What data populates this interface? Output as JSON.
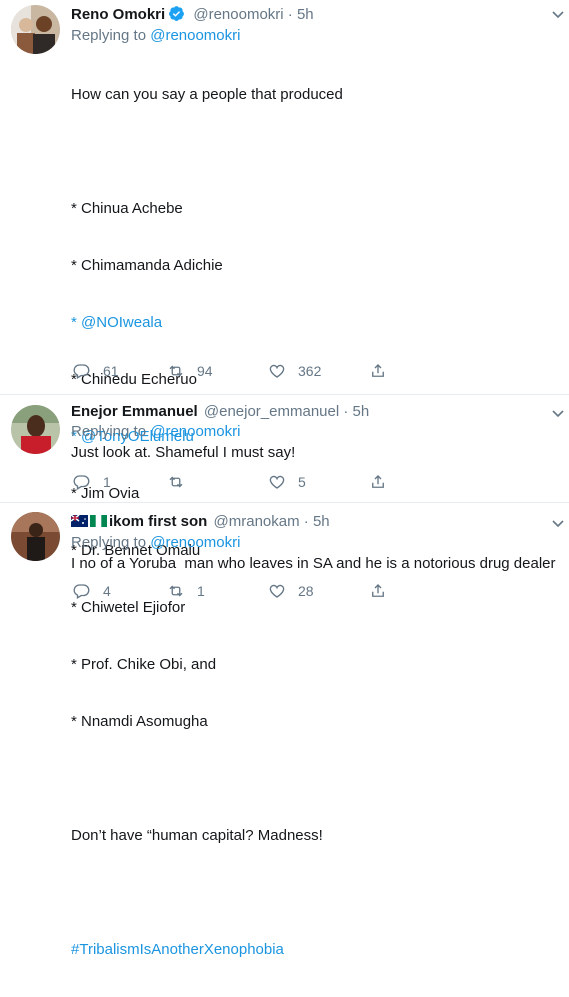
{
  "tweets": [
    {
      "name": "Reno Omokri",
      "handle": "@renoomokri",
      "dot": "·",
      "time": "5h",
      "replying_prefix": "Replying to ",
      "replying_handle": "@renoomokri",
      "body": {
        "line1": "How can you say a people that produced",
        "list": [
          {
            "text": "* Chinua Achebe",
            "link": false
          },
          {
            "text": "* Chimamanda Adichie",
            "link": false
          },
          {
            "prefix": "* ",
            "text": "@NOIweala",
            "link": true
          },
          {
            "text": "* Chinedu Echeruo",
            "link": false
          },
          {
            "prefix": "* ",
            "text": "@TonyOElumelu",
            "link": true
          },
          {
            "text": "* Jim Ovia",
            "link": false
          },
          {
            "text": "* Dr. Bennet Omalu",
            "link": false
          },
          {
            "text": "* Chiwetel Ejiofor",
            "link": false
          },
          {
            "text": "* Prof. Chike Obi, and",
            "link": false
          },
          {
            "text": "* Nnamdi Asomugha",
            "link": false
          }
        ],
        "closing": "Don’t have “human capital? Madness!",
        "hashtag": "#TribalismIsAnotherXenophobia"
      },
      "counts": {
        "reply": "61",
        "retweet": "94",
        "like": "362"
      }
    },
    {
      "name": "Enejor Emmanuel",
      "handle": "@enejor_emmanuel",
      "dot": "·",
      "time": "5h",
      "replying_prefix": "Replying to ",
      "replying_handle": "@renoomokri",
      "body": "Just look at. Shameful I must say!",
      "counts": {
        "reply": "1",
        "retweet": "",
        "like": "5"
      }
    },
    {
      "name": "ikom first son",
      "handle": "@mranokam",
      "dot": "·",
      "time": "5h",
      "replying_prefix": "Replying to ",
      "replying_handle": "@renoomokri",
      "body": "I no of a Yoruba  man who leaves in SA and he is a notorious drug dealer",
      "counts": {
        "reply": "4",
        "retweet": "1",
        "like": "28"
      }
    }
  ],
  "colors": {
    "link": "#1b95e0",
    "muted": "#657786",
    "divider": "#e6ecf0"
  },
  "icons": [
    "verified-badge-icon",
    "chevron-down-icon",
    "reply-icon",
    "retweet-icon",
    "like-icon",
    "share-icon"
  ]
}
